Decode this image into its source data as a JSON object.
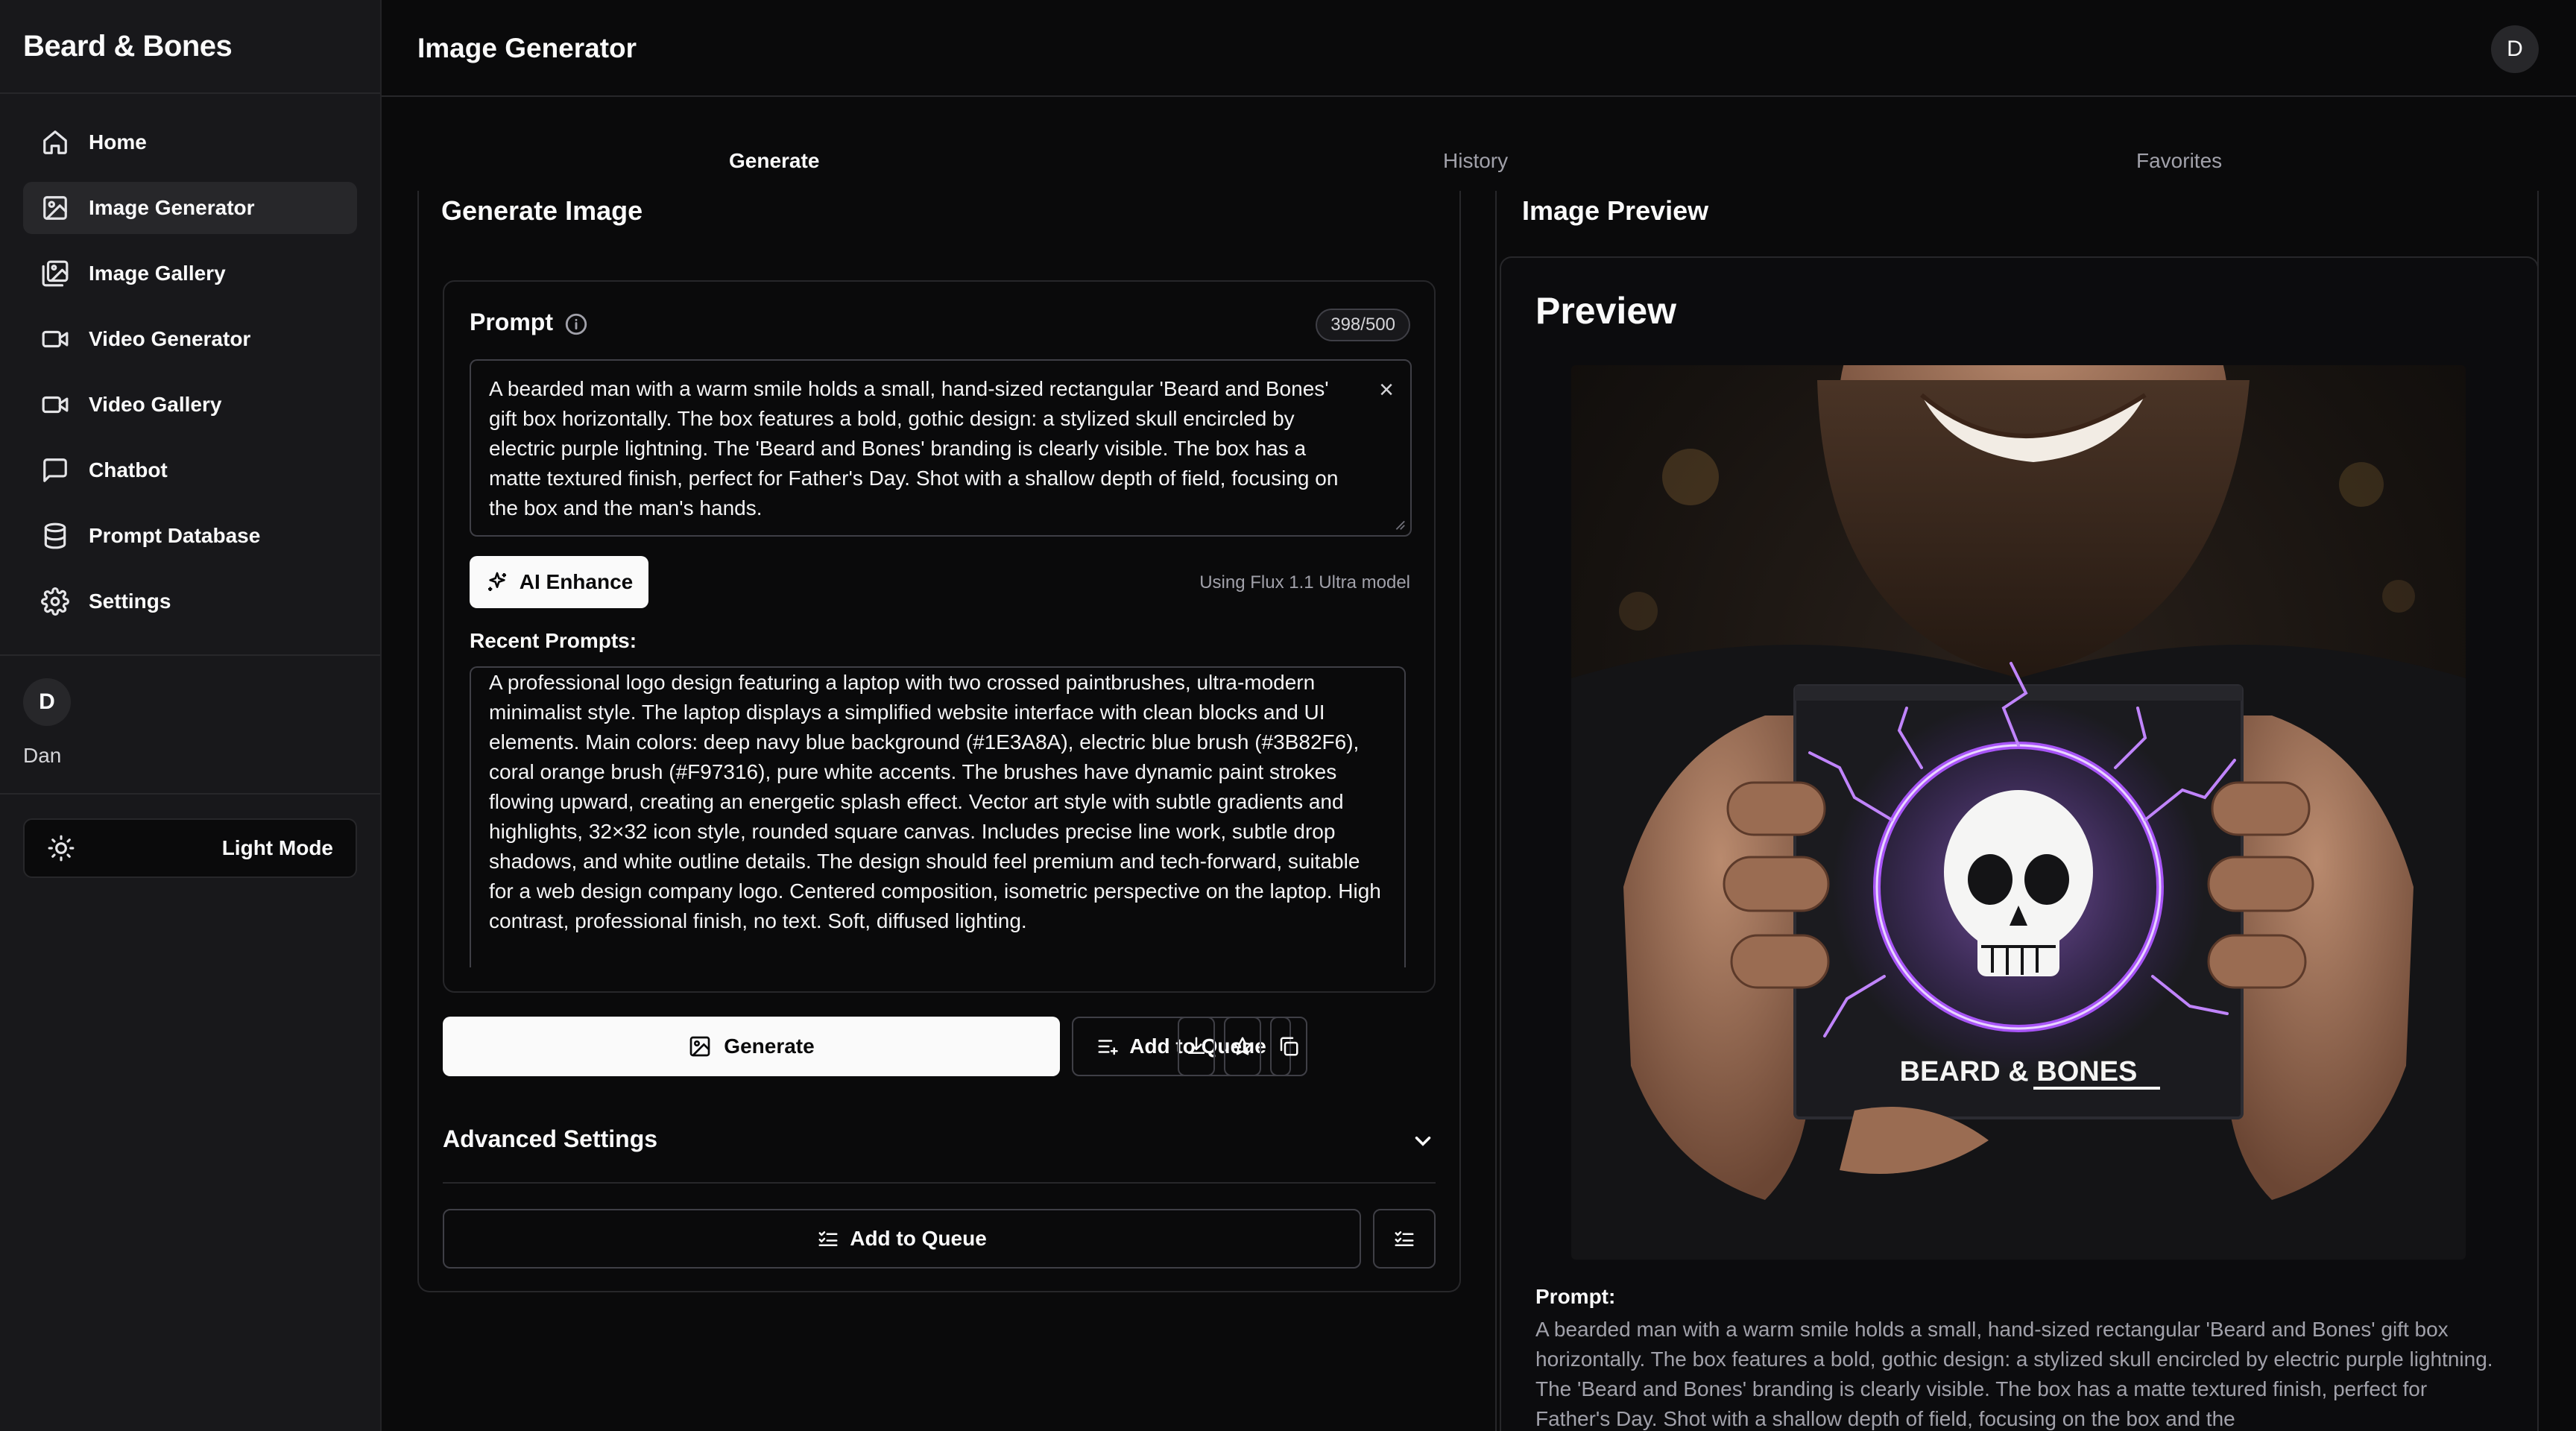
{
  "app": {
    "brand": "Beard & Bones",
    "page_title": "Image Generator",
    "avatar_letter": "D"
  },
  "sidebar": {
    "items": [
      {
        "label": "Home",
        "icon": "home-icon"
      },
      {
        "label": "Image Generator",
        "icon": "image-icon"
      },
      {
        "label": "Image Gallery",
        "icon": "gallery-icon"
      },
      {
        "label": "Video Generator",
        "icon": "video-icon"
      },
      {
        "label": "Video Gallery",
        "icon": "video-icon"
      },
      {
        "label": "Chatbot",
        "icon": "chat-icon"
      },
      {
        "label": "Prompt Database",
        "icon": "database-icon"
      },
      {
        "label": "Settings",
        "icon": "gear-icon"
      }
    ],
    "active_index": 1,
    "user": {
      "initial": "D",
      "name": "Dan"
    },
    "mode_button": "Light Mode"
  },
  "tabs": {
    "generate": "Generate",
    "history": "History",
    "favorites": "Favorites"
  },
  "generate_panel": {
    "title": "Generate Image",
    "prompt_label": "Prompt",
    "char_count": "398/500",
    "prompt_text": "A bearded man with a warm smile holds a small, hand-sized rectangular 'Beard and Bones' gift box horizontally. The box features a bold, gothic design: a stylized skull encircled by electric purple lightning. The 'Beard and Bones' branding is clearly visible. The box has a matte textured finish, perfect for Father's Day. Shot with a shallow depth of field, focusing on the box and the man's hands.",
    "enhance_label": "AI Enhance",
    "model_note": "Using Flux 1.1 Ultra model",
    "recent_label": "Recent Prompts:",
    "recent_prompt": "A professional logo design featuring a laptop with two crossed paintbrushes, ultra-modern minimalist style. The laptop displays a simplified website interface with clean blocks and UI elements. Main colors: deep navy blue background (#1E3A8A), electric blue brush (#3B82F6), coral orange brush (#F97316), pure white accents. The brushes have dynamic paint strokes flowing upward, creating an energetic splash effect. Vector art style with subtle gradients and highlights, 32×32 icon style, rounded square canvas. Includes precise line work, subtle drop shadows, and white outline details. The design should feel premium and tech-forward, suitable for a web design company logo. Centered composition, isometric perspective on the laptop. High contrast, professional finish, no text. Soft, diffused lighting.",
    "generate_label": "Generate",
    "add_queue_label": "Add to Queue",
    "advanced_label": "Advanced Settings",
    "queue_wide_label": "Add to Queue"
  },
  "preview_panel": {
    "title": "Image Preview",
    "heading": "Preview",
    "box_brand": "BEARD & BONES",
    "prompt_label": "Prompt:",
    "prompt_text": "A bearded man with a warm smile holds a small, hand-sized rectangular 'Beard and Bones' gift box horizontally. The box features a bold, gothic design: a stylized skull encircled by electric purple lightning. The 'Beard and Bones' branding is clearly visible. The box has a matte textured finish, perfect for Father's Day. Shot with a shallow depth of field, focusing on the box and the"
  },
  "colors": {
    "accent_purple": "#8b5cf6",
    "background": "#0a0a0b",
    "sidebar": "#18181b",
    "border": "#27272a"
  }
}
